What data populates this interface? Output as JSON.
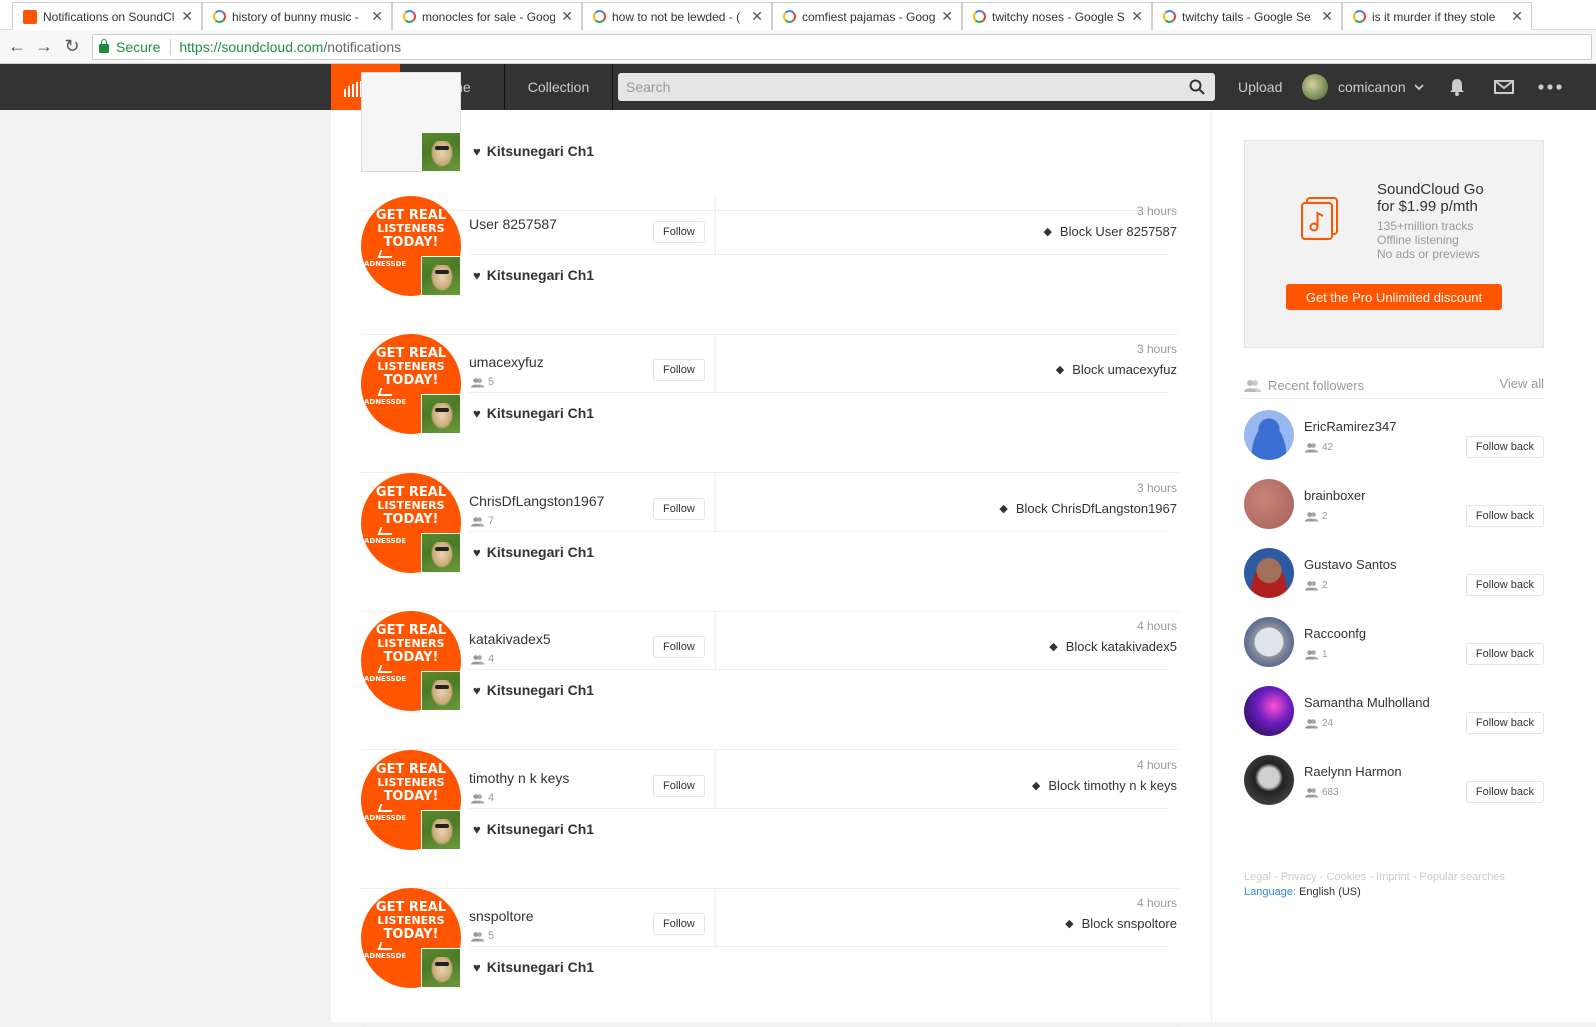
{
  "browser": {
    "tabs": [
      {
        "title": "Notifications on SoundCl",
        "favicon": "soundcloud-icon",
        "active": true
      },
      {
        "title": "history of bunny music -",
        "favicon": "google-icon"
      },
      {
        "title": "monocles for sale - Goog",
        "favicon": "google-icon"
      },
      {
        "title": "how to not be lewded - (",
        "favicon": "google-icon"
      },
      {
        "title": "comfiest pajamas - Goog",
        "favicon": "google-icon"
      },
      {
        "title": "twitchy noses - Google S",
        "favicon": "google-icon"
      },
      {
        "title": "twitchy tails - Google Se",
        "favicon": "google-icon"
      },
      {
        "title": "is it murder if they stole",
        "favicon": "google-icon"
      }
    ],
    "secure_label": "Secure",
    "url_scheme_host": "https://soundcloud.com",
    "url_path": "/notifications"
  },
  "header": {
    "nav": [
      "Home",
      "Collection"
    ],
    "search_placeholder": "Search",
    "upload": "Upload",
    "username": "comicanon"
  },
  "colors": {
    "accent": "#ff5500",
    "header_bg": "#333333"
  },
  "notifications": [
    {
      "username": "",
      "followers": "",
      "time": "",
      "block": "",
      "track": "Kitsunegari Ch1",
      "partial": true
    },
    {
      "username": "User 8257587",
      "followers": "",
      "time": "3 hours",
      "block": "Block User 8257587",
      "track": "Kitsunegari Ch1"
    },
    {
      "username": "umacexyfuz",
      "followers": "5",
      "time": "3 hours",
      "block": "Block umacexyfuz",
      "track": "Kitsunegari Ch1"
    },
    {
      "username": "ChrisDfLangston1967",
      "followers": "7",
      "time": "3 hours",
      "block": "Block ChrisDfLangston1967",
      "track": "Kitsunegari Ch1"
    },
    {
      "username": "katakivadex5",
      "followers": "4",
      "time": "4 hours",
      "block": "Block katakivadex5",
      "track": "Kitsunegari Ch1"
    },
    {
      "username": "timothy n k keys",
      "followers": "4",
      "time": "4 hours",
      "block": "Block timothy n k keys",
      "track": "Kitsunegari Ch1"
    },
    {
      "username": "snspoltore",
      "followers": "5",
      "time": "4 hours",
      "block": "Block snspoltore",
      "track": "Kitsunegari Ch1"
    }
  ],
  "artwork_text": {
    "line1": "GET REAL",
    "line2": "LISTENERS",
    "line3": "TODAY!",
    "line4": "MADNESSDE"
  },
  "follow_label": "Follow",
  "promo": {
    "title_line1": "SoundCloud Go",
    "title_line2": "for $1.99 p/mth",
    "features": [
      "135+million tracks",
      "Offline listening",
      "No ads or previews"
    ],
    "button": "Get the Pro Unlimited discount"
  },
  "recent_followers": {
    "title": "Recent followers",
    "view_all": "View all",
    "follow_back": "Follow back",
    "items": [
      {
        "name": "EricRamirez347",
        "count": "42"
      },
      {
        "name": "brainboxer",
        "count": "2"
      },
      {
        "name": "Gustavo Santos",
        "count": "2"
      },
      {
        "name": "Raccoonfg",
        "count": "1"
      },
      {
        "name": "Samantha Mulholland",
        "count": "24"
      },
      {
        "name": "Raelynn Harmon",
        "count": "683"
      }
    ]
  },
  "footer": {
    "links": "Legal - Privacy - Cookies - Imprint - Popular searches",
    "language_label": "Language:",
    "language_value": "English (US)"
  }
}
